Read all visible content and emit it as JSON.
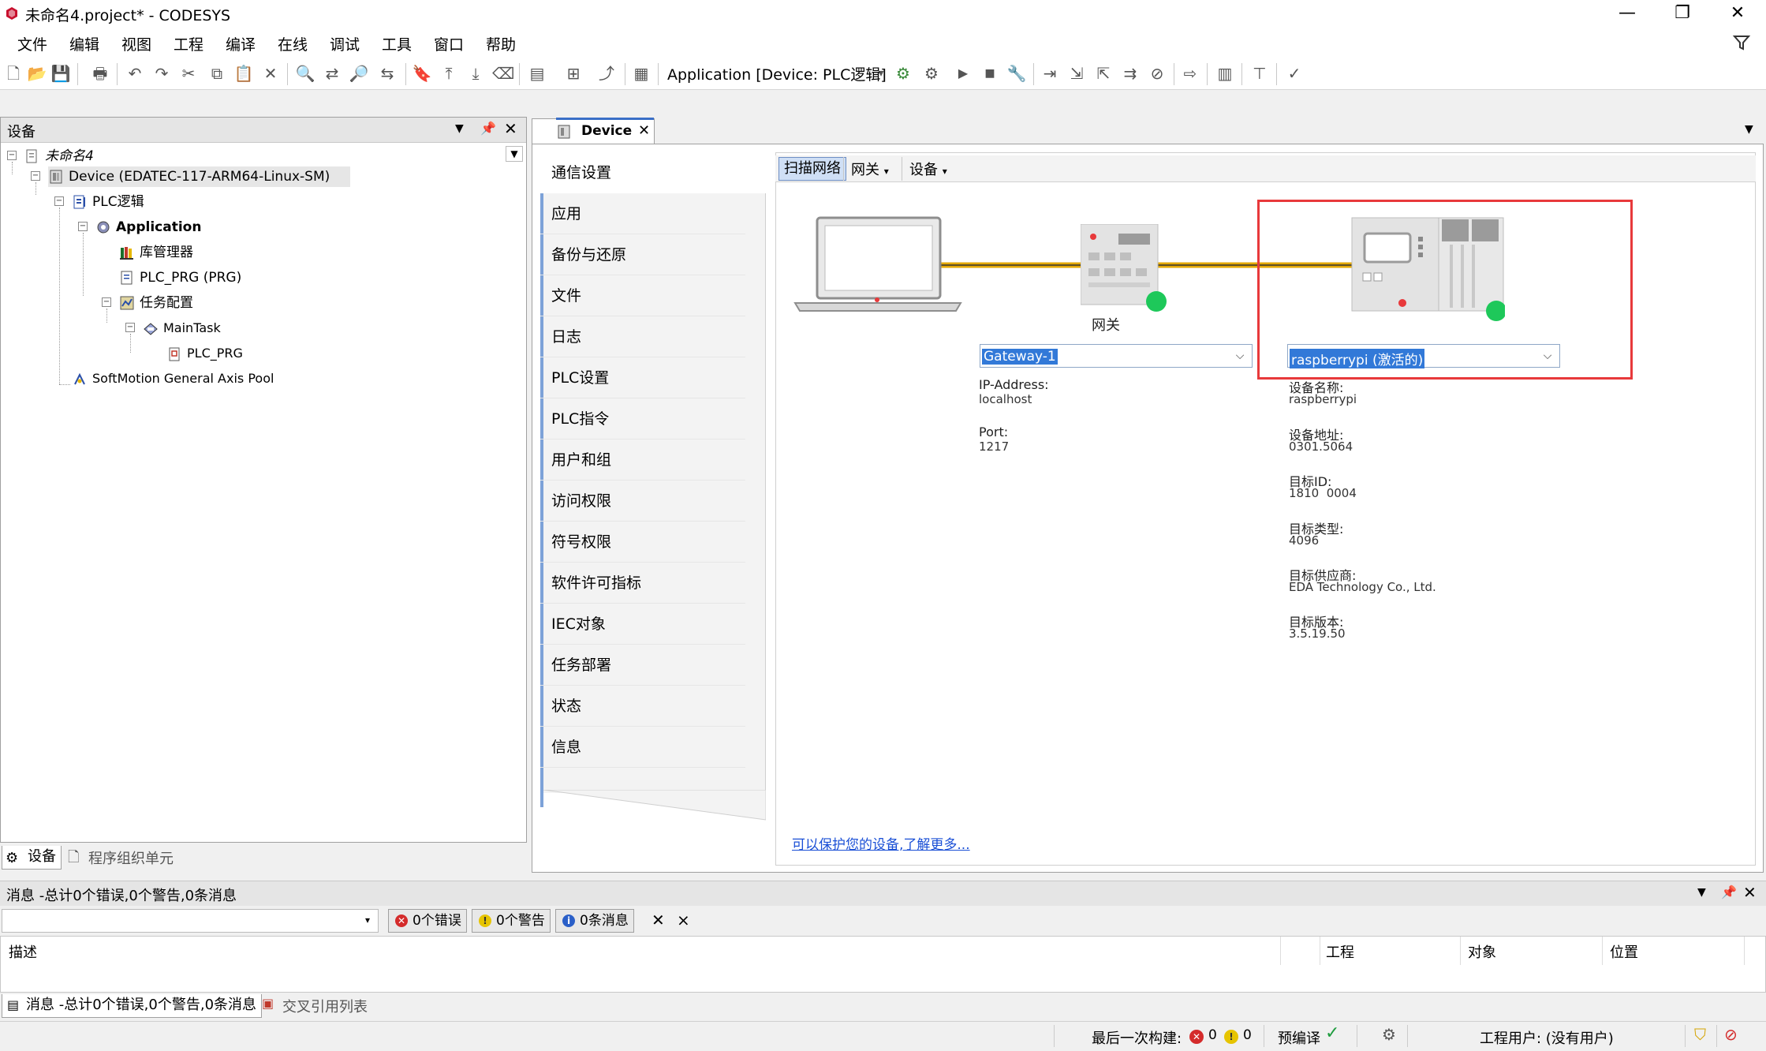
{
  "window": {
    "title": "未命名4.project* - CODESYS",
    "minimize": "—",
    "restore": "❐",
    "close": "✕"
  },
  "menu": [
    "文件",
    "编辑",
    "视图",
    "工程",
    "编译",
    "在线",
    "调试",
    "工具",
    "窗口",
    "帮助"
  ],
  "toolbar": {
    "app_selector": "Application [Device: PLC逻辑]"
  },
  "devices_panel": {
    "title": "设备",
    "tree": [
      {
        "label": "未命名4",
        "icon": "project-icon"
      },
      {
        "label": "Device (EDATEC-117-ARM64-Linux-SM)",
        "icon": "device-icon"
      },
      {
        "label": "PLC逻辑",
        "icon": "plc-logic-icon"
      },
      {
        "label": "Application",
        "icon": "application-gear-icon"
      },
      {
        "label": "库管理器",
        "icon": "library-icon"
      },
      {
        "label": "PLC_PRG (PRG)",
        "icon": "pou-icon"
      },
      {
        "label": "任务配置",
        "icon": "task-config-icon"
      },
      {
        "label": "MainTask",
        "icon": "task-icon"
      },
      {
        "label": "PLC_PRG",
        "icon": "pou-call-icon"
      },
      {
        "label": "SoftMotion General Axis Pool",
        "icon": "axis-pool-icon"
      }
    ],
    "tabs": [
      "设备",
      "程序组织单元"
    ]
  },
  "editor": {
    "tab_label": "Device",
    "nav": [
      "通信设置",
      "应用",
      "备份与还原",
      "文件",
      "日志",
      "PLC设置",
      "PLC指令",
      "用户和组",
      "访问权限",
      "符号权限",
      "软件许可指标",
      "IEC对象",
      "任务部署",
      "状态",
      "信息"
    ],
    "subtoolbar": {
      "scan": "扫描网络",
      "gateway": "网关",
      "device": "设备"
    },
    "gateway_label": "网关",
    "gateway_combo": "Gateway-1",
    "gateway_info": {
      "ip_label": "IP-Address:",
      "ip_value": "localhost",
      "port_label": "Port:",
      "port_value": "1217"
    },
    "device_combo": "raspberrypi (激活的)",
    "device_info": [
      {
        "label": "设备名称:",
        "value": "raspberrypi"
      },
      {
        "label": "设备地址:",
        "value": "0301.5064"
      },
      {
        "label": "目标ID:",
        "value": "1810  0004"
      },
      {
        "label": "目标类型:",
        "value": "4096"
      },
      {
        "label": "目标供应商:",
        "value": "EDA Technology Co., Ltd."
      },
      {
        "label": "目标版本:",
        "value": "3.5.19.50"
      }
    ],
    "protect_link": "可以保护您的设备,了解更多...",
    "highlight_color": "#e8393b",
    "status_green": "#1ec85a",
    "cable_color": "#e4a800"
  },
  "messages": {
    "header": "消息 -总计0个错误,0个警告,0条消息",
    "errors_btn": "0个错误",
    "warnings_btn": "0个警告",
    "messages_btn": "0条消息",
    "columns": [
      "描述",
      "工程",
      "对象",
      "位置"
    ],
    "tabs": [
      "消息 -总计0个错误,0个警告,0条消息",
      "交叉引用列表"
    ]
  },
  "statusbar": {
    "last_build": "最后一次构建:",
    "errors": "0",
    "warnings": "0",
    "precompile": "预编译",
    "project_user": "工程用户: (没有用户)"
  }
}
